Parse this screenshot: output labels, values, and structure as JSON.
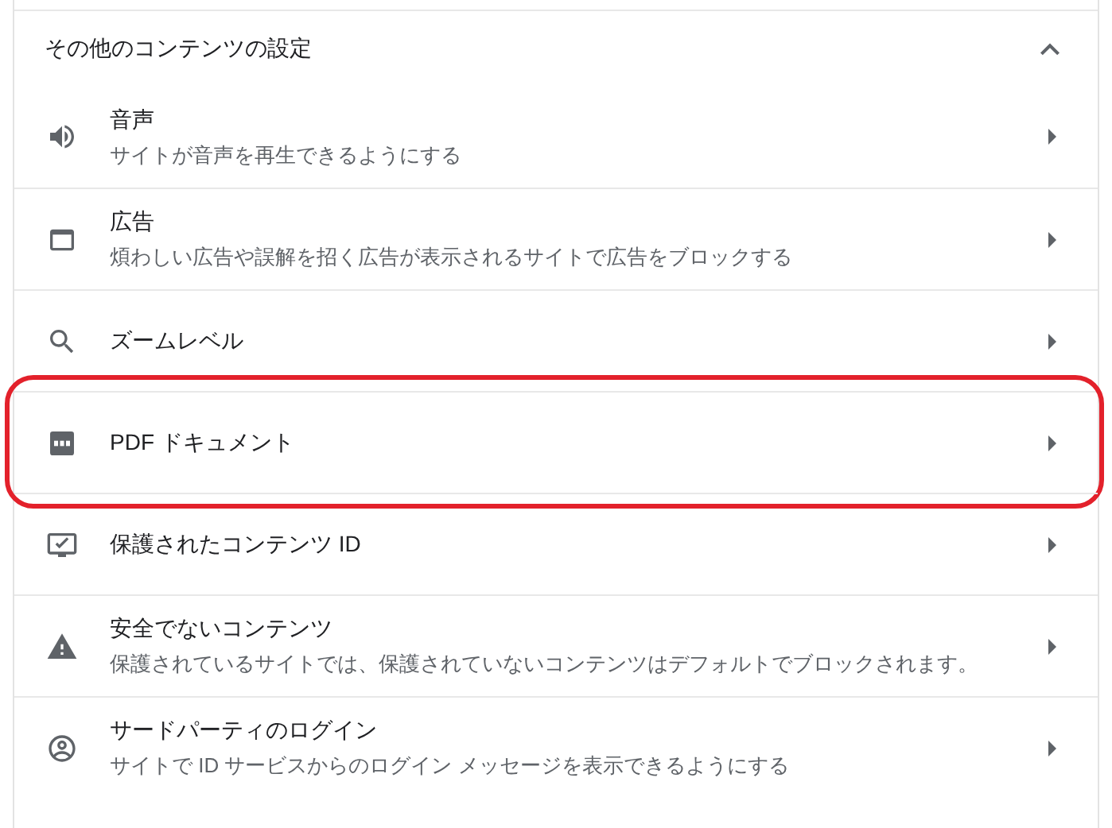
{
  "section": {
    "title": "その他のコンテンツの設定",
    "expanded": true
  },
  "rows": [
    {
      "title": "音声",
      "description": "サイトが音声を再生できるようにする",
      "highlighted": false
    },
    {
      "title": "広告",
      "description": "煩わしい広告や誤解を招く広告が表示されるサイトで広告をブロックする",
      "highlighted": false
    },
    {
      "title": "ズームレベル",
      "highlighted": false
    },
    {
      "title": "PDF ドキュメント",
      "highlighted": true
    },
    {
      "title": "保護されたコンテンツ ID",
      "highlighted": false
    },
    {
      "title": "安全でないコンテンツ",
      "description": "保護されているサイトでは、保護されていないコンテンツはデフォルトでブロックされます。",
      "highlighted": false
    },
    {
      "title": "サードパーティのログイン",
      "description": "サイトで ID サービスからのログイン メッセージを表示できるようにする",
      "highlighted": false
    }
  ]
}
